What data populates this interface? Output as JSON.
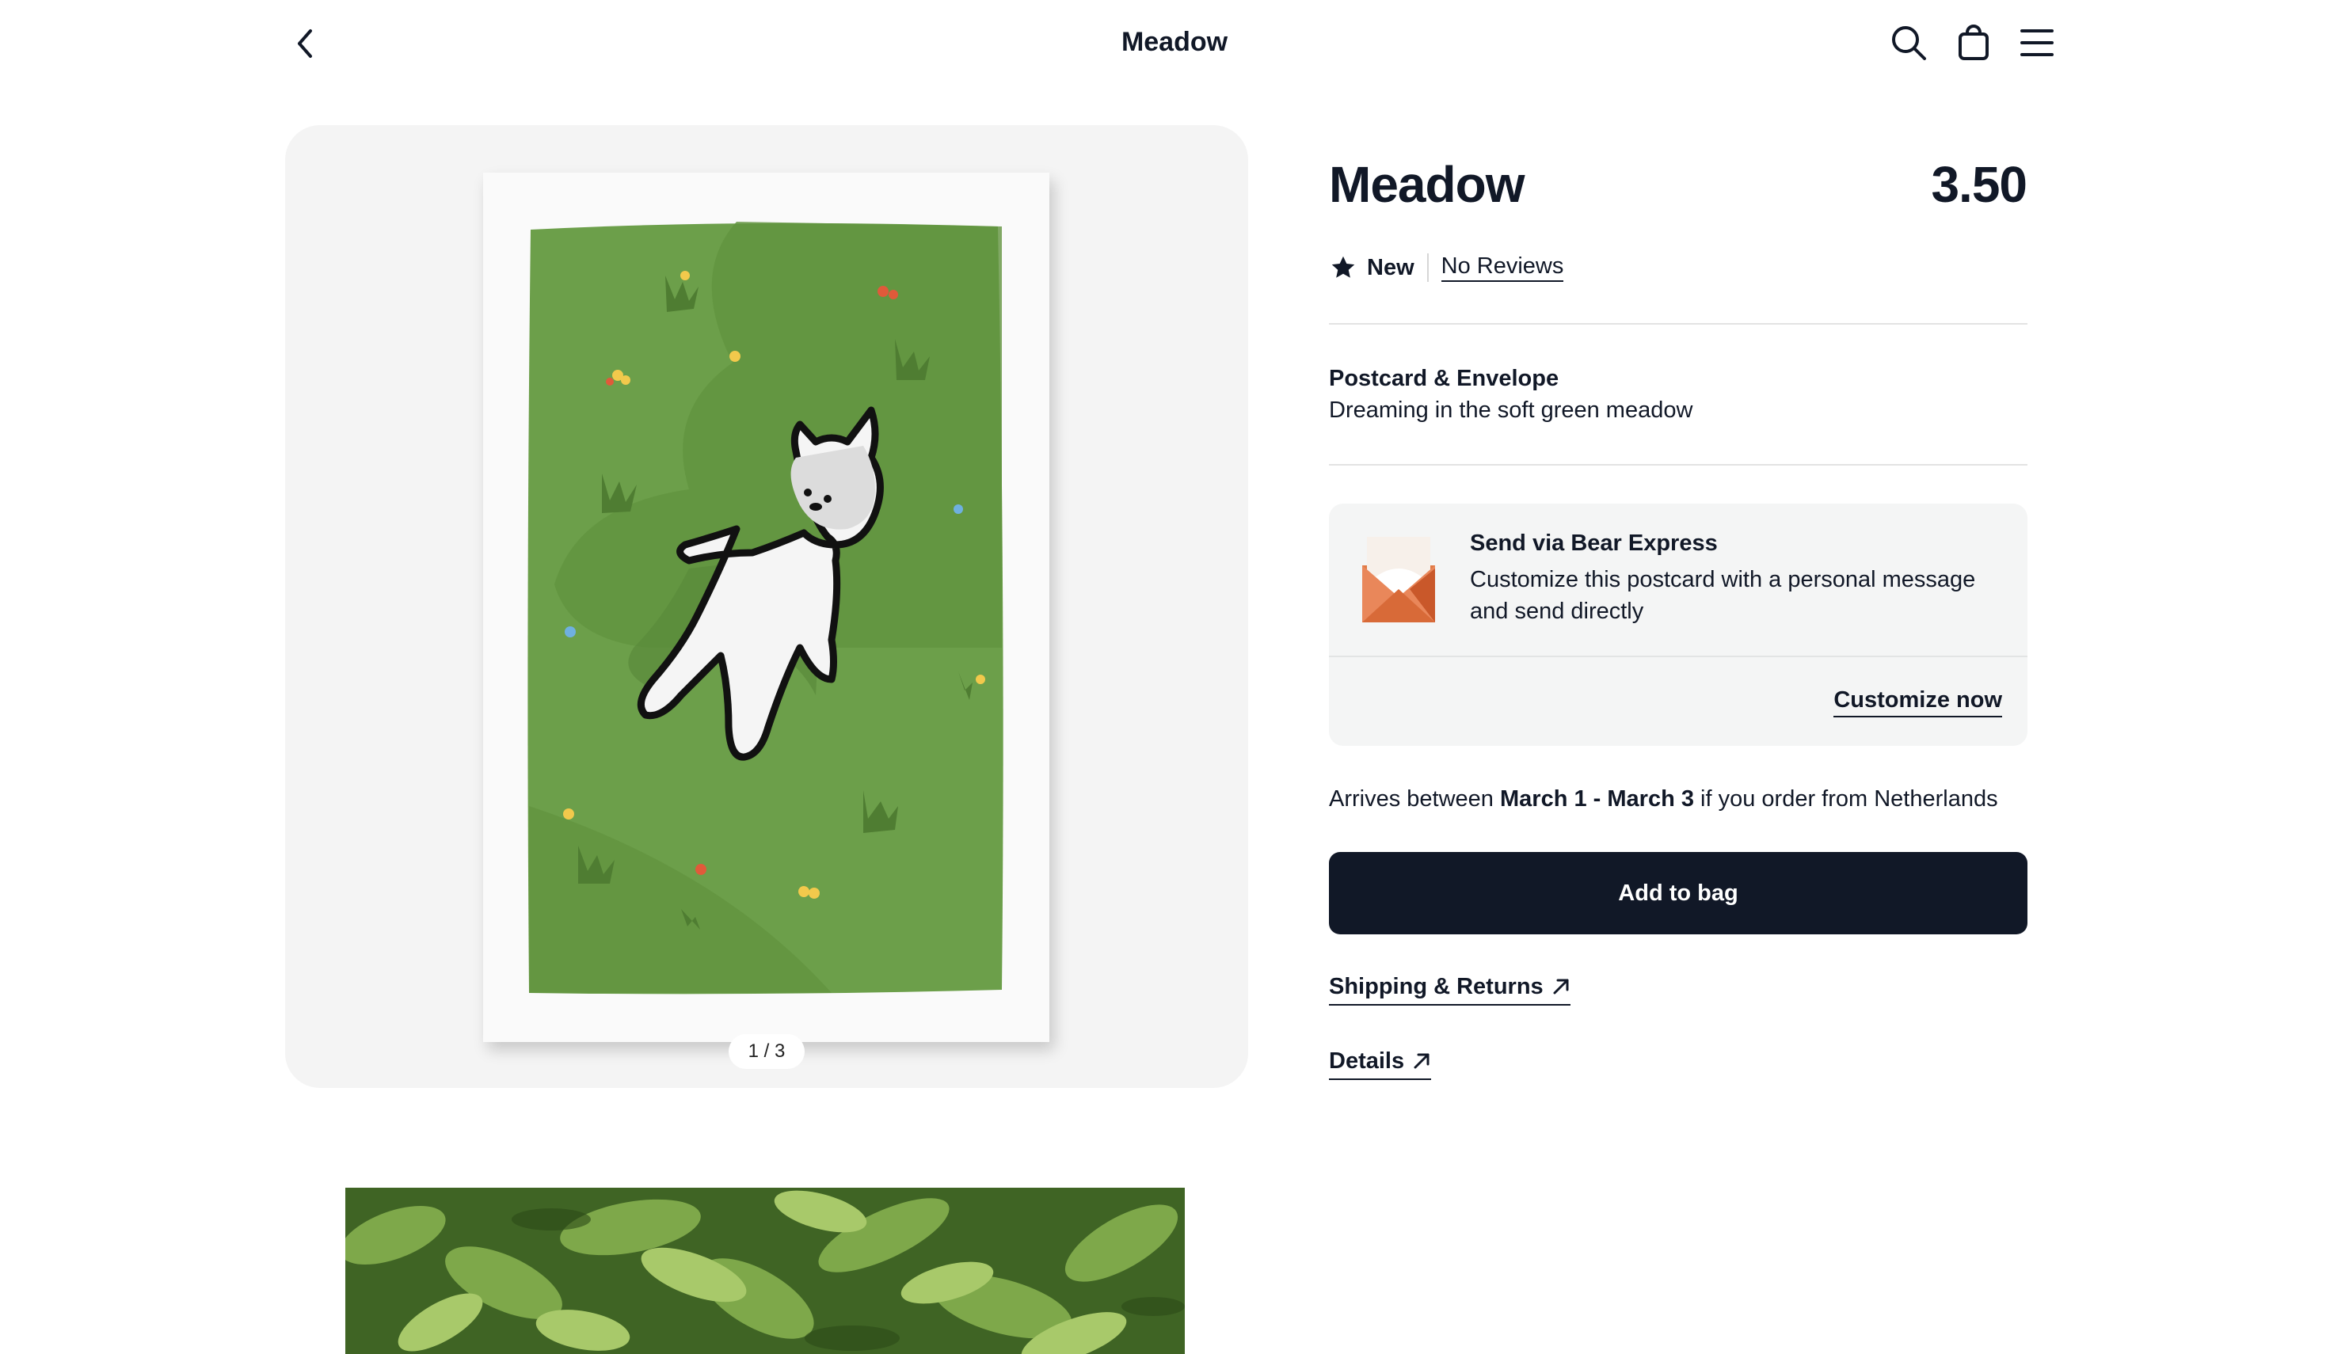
{
  "header": {
    "title": "Meadow",
    "back_icon": "chevron-left-icon",
    "search_icon": "search-icon",
    "bag_icon": "shopping-bag-icon",
    "menu_icon": "menu-icon"
  },
  "gallery": {
    "counter": "1 / 3",
    "current_image": 1,
    "total_images": 3
  },
  "product": {
    "title": "Meadow",
    "price": "3.50",
    "badge": "New",
    "badge_icon": "star-icon",
    "reviews_link": "No Reviews",
    "variant_name": "Postcard & Envelope",
    "variant_desc": "Dreaming in the soft green meadow"
  },
  "bear_express": {
    "icon": "envelope-icon",
    "title": "Send via Bear Express",
    "desc": "Customize this postcard with a personal message and send directly",
    "cta": "Customize now"
  },
  "delivery": {
    "prefix": "Arrives between",
    "range": "March 1 - March 3",
    "suffix": "if you order from Netherlands"
  },
  "actions": {
    "add_to_bag": "Add to bag",
    "shipping_link": "Shipping & Returns",
    "details_link": "Details",
    "link_icon": "arrow-up-right-icon"
  },
  "colors": {
    "primary": "#111827",
    "panel": "#f4f4f4",
    "card_green": "#6c9f4a",
    "envelope": "#e07a45"
  }
}
